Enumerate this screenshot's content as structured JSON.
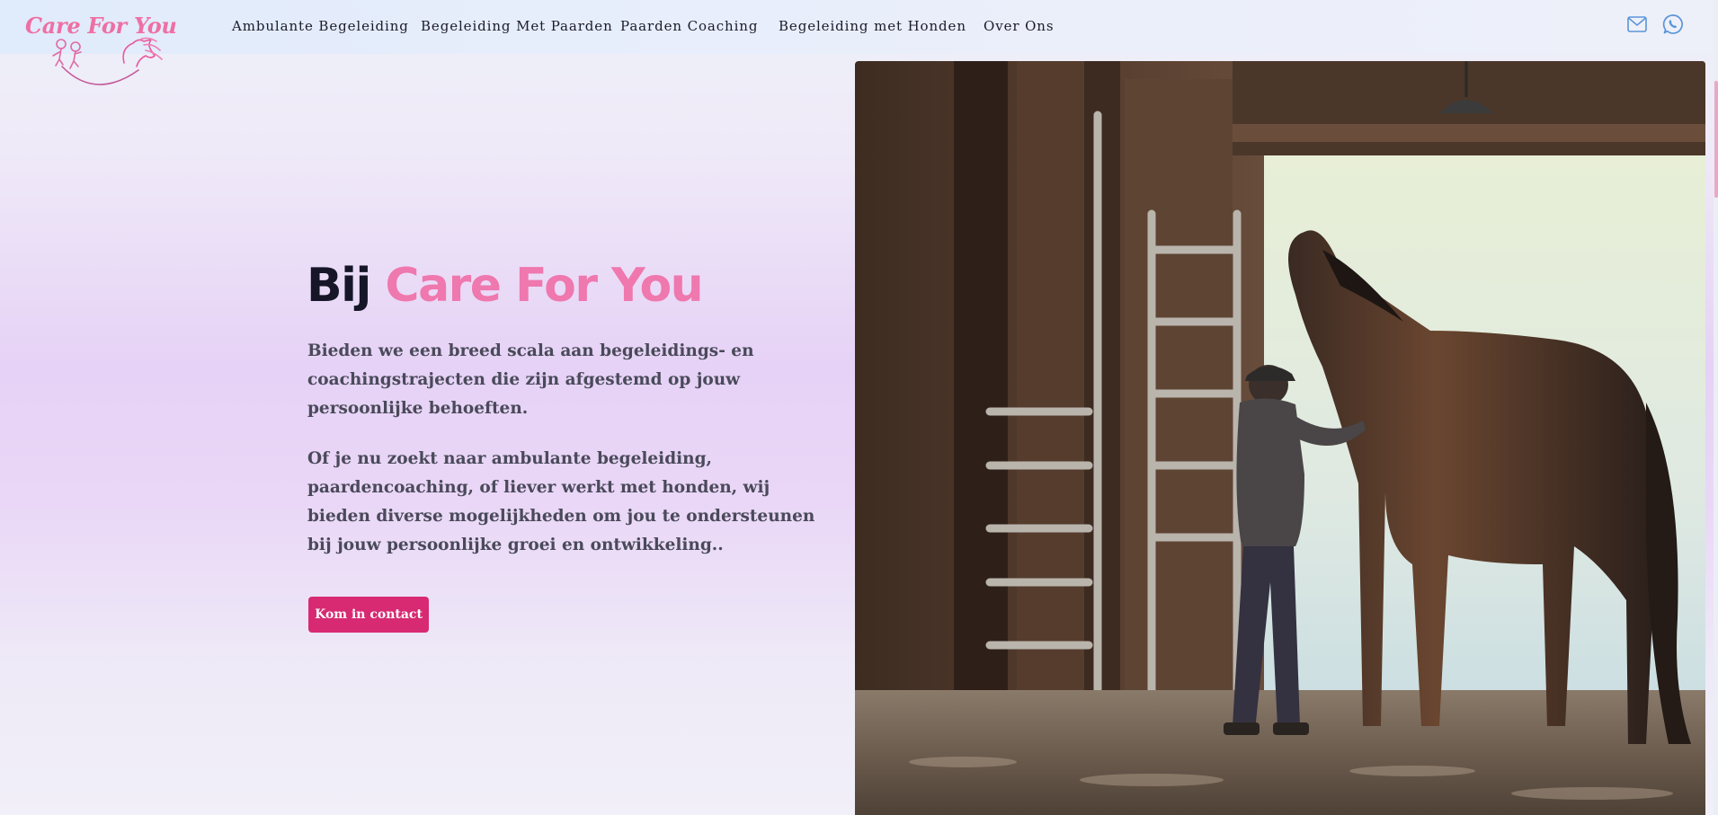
{
  "brand": {
    "name": "Care For You",
    "primary_color": "#ef78ae",
    "accent_color": "#d72a72",
    "text_color": "#161628"
  },
  "nav": {
    "items": [
      {
        "label": "Ambulante Begeleiding"
      },
      {
        "label": "Begeleiding Met Paarden"
      },
      {
        "label": "Paarden Coaching"
      },
      {
        "label": "Begeleiding met Honden"
      },
      {
        "label": "Over Ons"
      }
    ],
    "icons": [
      "mail-icon",
      "whatsapp-icon"
    ]
  },
  "hero": {
    "title_prefix": "Bij",
    "title_highlight": "Care For You",
    "paragraph_1": "Bieden we een breed scala aan begeleidings- en coachingstrajecten die zijn afgestemd op jouw persoonlijke behoeften.",
    "paragraph_2": "Of je nu zoekt naar ambulante begeleiding, paardencoaching, of liever werkt met honden, wij bieden diverse mogelijkheden om jou te ondersteunen bij jouw persoonlijke groei en ontwikkeling..",
    "cta_label": "Kom in contact",
    "image_subject": "man-with-horse-in-stable"
  }
}
